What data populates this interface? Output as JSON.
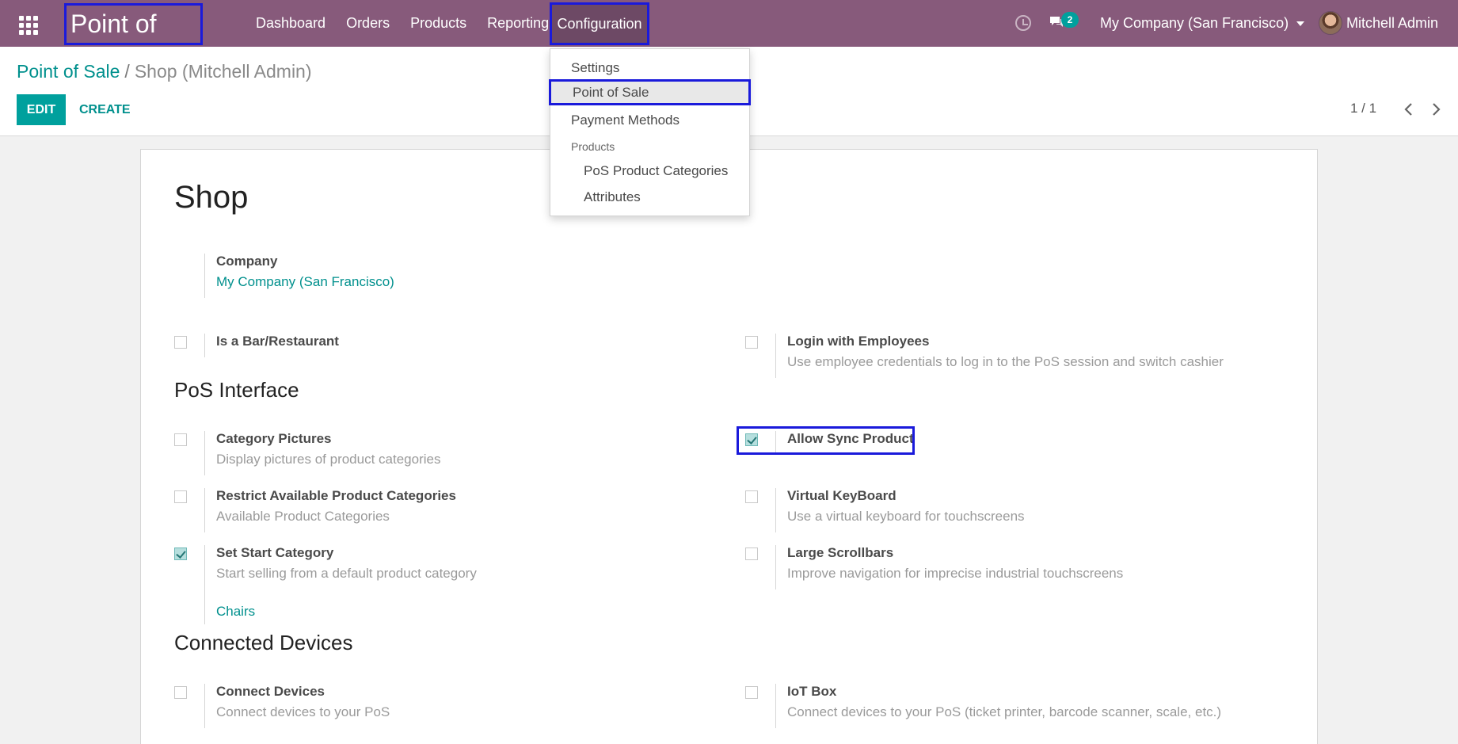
{
  "navbar": {
    "brand": "Point of Sale",
    "menu": [
      "Dashboard",
      "Orders",
      "Products",
      "Reporting"
    ],
    "config_label": "Configuration",
    "chat_count": "2",
    "company": "My Company (San Francisco)",
    "user": "Mitchell Admin"
  },
  "breadcrumb": {
    "parent": "Point of Sale",
    "separator": "/",
    "current": "Shop (Mitchell Admin)"
  },
  "actions": {
    "edit": "EDIT",
    "create": "CREATE"
  },
  "pager": {
    "value": "1 / 1"
  },
  "dropdown": {
    "items": [
      "Settings",
      "Point of Sale",
      "Payment Methods"
    ],
    "products_header": "Products",
    "product_items": [
      "PoS Product Categories",
      "Attributes"
    ]
  },
  "form": {
    "title": "Shop",
    "company_label": "Company",
    "company_value": "My Company (San Francisco)",
    "bar_restaurant": "Is a Bar/Restaurant",
    "login_employees": {
      "label": "Login with Employees",
      "desc": "Use employee credentials to log in to the PoS session and switch cashier"
    },
    "pos_interface": "PoS Interface",
    "category_pictures": {
      "label": "Category Pictures",
      "desc": "Display pictures of product categories"
    },
    "allow_sync": {
      "label": "Allow Sync Product",
      "checked": true
    },
    "restrict_categories": {
      "label": "Restrict Available Product Categories",
      "desc": "Available Product Categories"
    },
    "virtual_keyboard": {
      "label": "Virtual KeyBoard",
      "desc": "Use a virtual keyboard for touchscreens"
    },
    "start_category": {
      "label": "Set Start Category",
      "desc": "Start selling from a default product category",
      "value": "Chairs",
      "checked": true
    },
    "large_scrollbars": {
      "label": "Large Scrollbars",
      "desc": "Improve navigation for imprecise industrial touchscreens"
    },
    "connected_devices": "Connected Devices",
    "connect_devices": {
      "label": "Connect Devices",
      "desc": "Connect devices to your PoS"
    },
    "iot_box": {
      "label": "IoT Box",
      "desc": "Connect devices to your PoS (ticket printer, barcode scanner, scale, etc.)"
    }
  },
  "colors": {
    "navbar": "#875a7b",
    "accent": "#00a09d",
    "highlight": "#1a1adb"
  }
}
